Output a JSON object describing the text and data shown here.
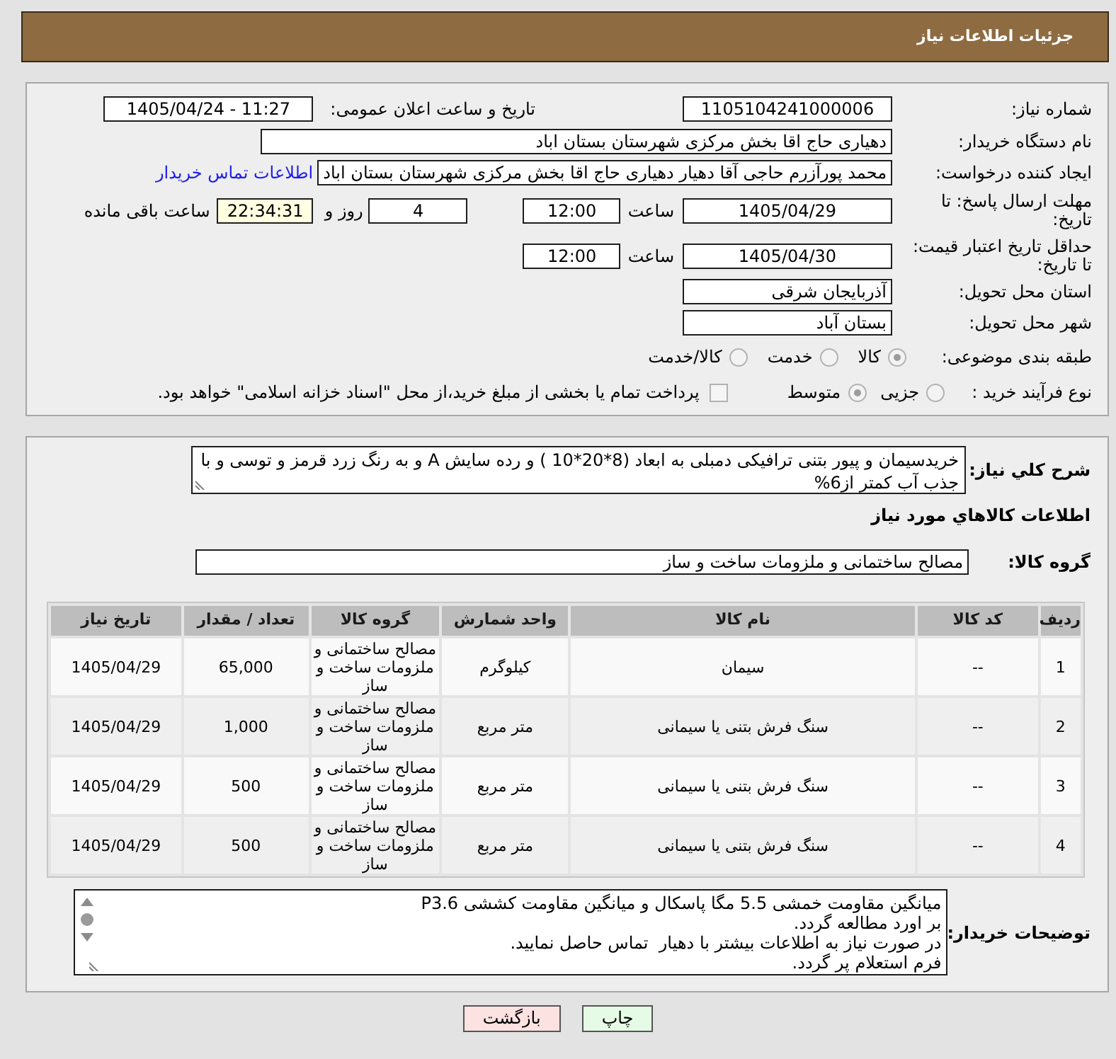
{
  "header": {
    "title": "جزئیات اطلاعات نیاز"
  },
  "need_number": {
    "label": "شماره نیاز:",
    "value": "1105104241000006"
  },
  "announcement": {
    "label": "تاریخ و ساعت اعلان عمومی:",
    "value": "1405/04/24 - 11:27"
  },
  "buyer_organization": {
    "label": "نام دستگاه خریدار:",
    "value": "دهیاری حاج اقا بخش مرکزی شهرستان بستان اباد"
  },
  "requester": {
    "label": "ایجاد کننده درخواست:",
    "value": "محمد پورآزرم حاجی آقا دهیار دهیاری حاج اقا بخش مرکزی شهرستان بستان اباد",
    "link": "اطلاعات تماس خریدار"
  },
  "response_deadline": {
    "label": "مهلت ارسال پاسخ: تا تاریخ:",
    "date": "1405/04/29",
    "time_label": "ساعت",
    "time": "12:00",
    "days": "4",
    "days_label": "روز و",
    "remaining": "22:34:31",
    "remaining_label": "ساعت باقی مانده"
  },
  "price_validity": {
    "label": "حداقل تاریخ اعتبار قیمت: تا تاریخ:",
    "date": "1405/04/30",
    "time_label": "ساعت",
    "time": "12:00"
  },
  "delivery_province": {
    "label": "استان محل تحویل:",
    "value": "آذربایجان شرقی"
  },
  "delivery_city": {
    "label": "شهر محل تحویل:",
    "value": "بستان آباد"
  },
  "subject_category": {
    "label": "طبقه بندی موضوعی:",
    "options": [
      {
        "label": "کالا",
        "selected": true
      },
      {
        "label": "خدمت",
        "selected": false
      },
      {
        "label": "کالا/خدمت",
        "selected": false
      }
    ]
  },
  "purchase_process": {
    "label": "نوع فرآیند خرید :",
    "options": [
      {
        "label": "جزیی",
        "selected": false
      },
      {
        "label": "متوسط",
        "selected": true
      }
    ],
    "treasury_payment": {
      "label": "پرداخت تمام یا بخشی از مبلغ خرید،از محل \"اسناد خزانه اسلامی\" خواهد بود.",
      "checked": false
    }
  },
  "general_description": {
    "label": "شرح کلي نياز:",
    "value": "خریدسیمان و پیور بتنی ترافیکی دمبلی به ابعاد (8*20*10 ) و رده سایش A و به رنگ زرد قرمز و توسی و با جذب آب کمتر از6%"
  },
  "goods_heading": "اطلاعات کالاهاي مورد نياز",
  "goods_group": {
    "label": "گروه کالا:",
    "value": "مصالح ساختمانی و ملزومات ساخت و ساز"
  },
  "table": {
    "columns": [
      "ردیف",
      "کد کالا",
      "نام کالا",
      "واحد شمارش",
      "گروه کالا",
      "تعداد / مقدار",
      "تاریخ نیاز"
    ],
    "rows": [
      [
        "1",
        "--",
        "سیمان",
        "کیلوگرم",
        "مصالح ساختمانی و ملزومات ساخت و ساز",
        "65,000",
        "1405/04/29"
      ],
      [
        "2",
        "--",
        "سنگ فرش بتنی یا سیمانی",
        "متر مربع",
        "مصالح ساختمانی و ملزومات ساخت و ساز",
        "1,000",
        "1405/04/29"
      ],
      [
        "3",
        "--",
        "سنگ فرش بتنی یا سیمانی",
        "متر مربع",
        "مصالح ساختمانی و ملزومات ساخت و ساز",
        "500",
        "1405/04/29"
      ],
      [
        "4",
        "--",
        "سنگ فرش بتنی یا سیمانی",
        "متر مربع",
        "مصالح ساختمانی و ملزومات ساخت و ساز",
        "500",
        "1405/04/29"
      ]
    ]
  },
  "buyer_notes": {
    "label": "توضیحات خریدار:",
    "lines": [
      "میانگین مقاومت خمشی 5.5 مگا پاسکال و میانگین مقاومت کششی P3.6",
      "بر اورد مطالعه گردد.",
      "در صورت نیاز به اطلاعات بیشتر با دهیار  تماس حاصل نمایید.",
      "فرم استعلام پر گردد."
    ]
  },
  "buttons": [
    {
      "label": "چاپ",
      "kind": "print"
    },
    {
      "label": "بازگشت",
      "kind": "back"
    }
  ]
}
